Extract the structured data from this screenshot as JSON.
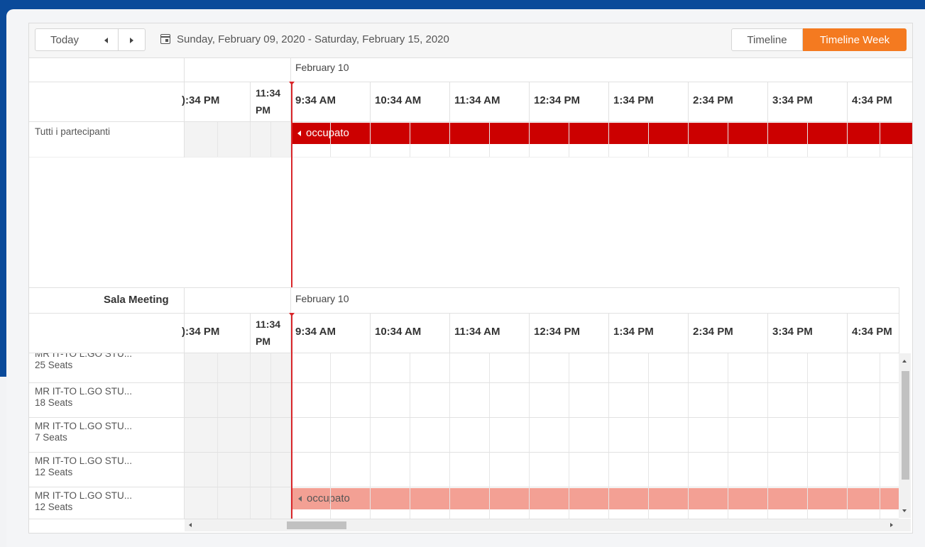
{
  "toolbar": {
    "today_label": "Today",
    "date_range": "Sunday, February 09, 2020 - Saturday, February 15, 2020",
    "view_timeline_label": "Timeline",
    "view_timeline_week_label": "Timeline Week",
    "active_view": "Timeline Week",
    "accent_color": "#f47a20"
  },
  "top_section": {
    "date_header": "February 10",
    "time_headers": [
      "):34 PM",
      "11:34 PM",
      "9:34 AM",
      "10:34 AM",
      "11:34 AM",
      "12:34 PM",
      "1:34 PM",
      "2:34 PM",
      "3:34 PM",
      "4:34 PM"
    ],
    "group_label": "Tutti i partecipanti",
    "appointment": {
      "label": "occupato",
      "color": "#cc0000"
    }
  },
  "bottom_section": {
    "group_title": "Sala Meeting",
    "date_header": "February 10",
    "time_headers": [
      "):34 PM",
      "11:34 PM",
      "9:34 AM",
      "10:34 AM",
      "11:34 AM",
      "12:34 PM",
      "1:34 PM",
      "2:34 PM",
      "3:34 PM",
      "4:34 PM"
    ],
    "resources": [
      {
        "name": "MR IT-TO L.GO STU...",
        "seats": "25 Seats"
      },
      {
        "name": "MR IT-TO L.GO STU...",
        "seats": "18 Seats"
      },
      {
        "name": "MR IT-TO L.GO STU...",
        "seats": "7 Seats"
      },
      {
        "name": "MR IT-TO L.GO STU...",
        "seats": "12 Seats"
      },
      {
        "name": "MR IT-TO L.GO STU...",
        "seats": "12 Seats"
      }
    ],
    "appointment": {
      "label": "occupato",
      "color": "#f3a094"
    }
  }
}
